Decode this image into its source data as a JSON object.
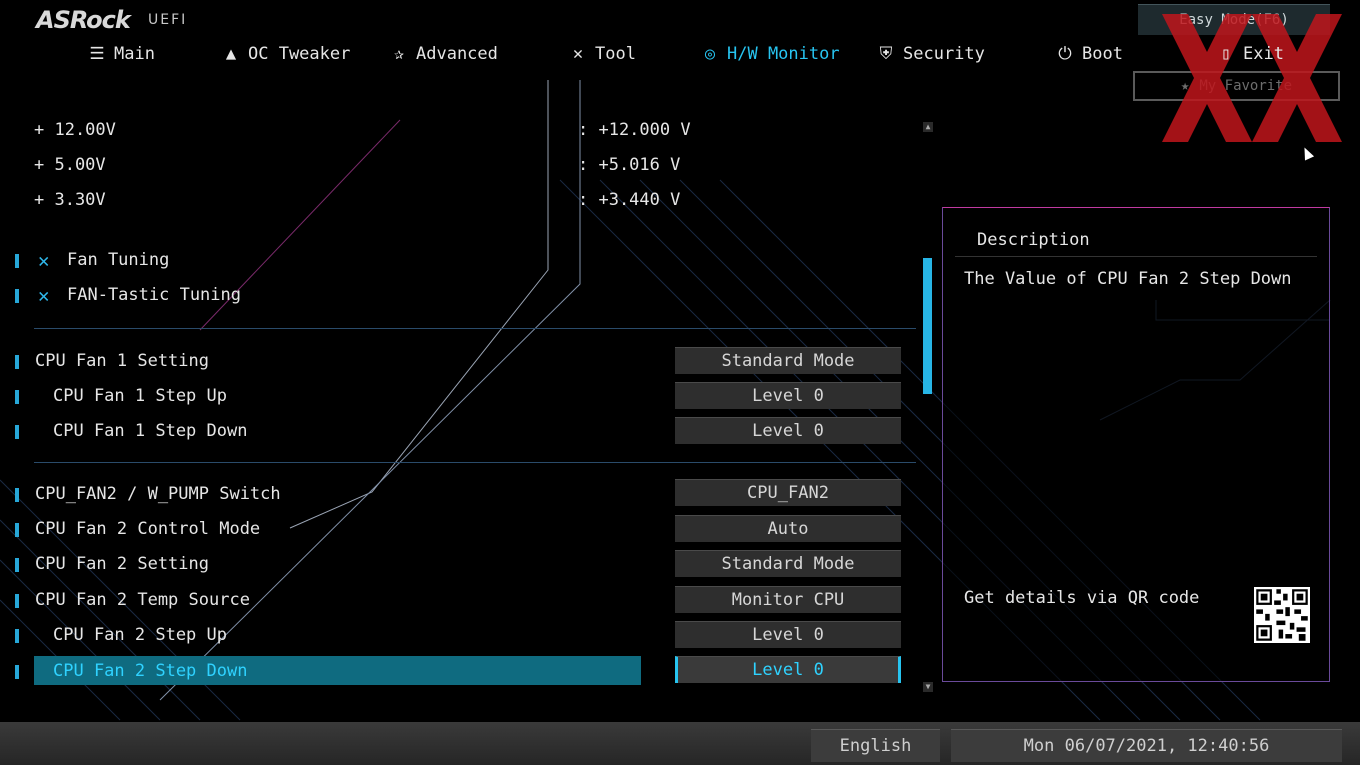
{
  "brand": {
    "logo": "ASRock",
    "sub": "UEFI"
  },
  "nav": [
    {
      "label": "Main",
      "icon": "list-icon"
    },
    {
      "label": "OC Tweaker",
      "icon": "rocket-icon"
    },
    {
      "label": "Advanced",
      "icon": "star-icon"
    },
    {
      "label": "Tool",
      "icon": "tools-icon"
    },
    {
      "label": "H/W Monitor",
      "icon": "monitor-icon"
    },
    {
      "label": "Security",
      "icon": "shield-icon"
    },
    {
      "label": "Boot",
      "icon": "power-icon"
    },
    {
      "label": "Exit",
      "icon": "exit-icon"
    }
  ],
  "active_tab": "H/W Monitor",
  "top_right": {
    "easy_mode": "Easy Mode(F6)",
    "favorite": "My Favorite"
  },
  "voltages": [
    {
      "label": "+ 12.00V",
      "value": ": +12.000 V"
    },
    {
      "label": "+ 5.00V",
      "value": ": +5.016 V"
    },
    {
      "label": "+ 3.30V",
      "value": ": +3.440 V"
    }
  ],
  "tools": [
    {
      "label": "Fan Tuning"
    },
    {
      "label": "FAN-Tastic Tuning"
    }
  ],
  "settings": [
    {
      "label": "CPU Fan 1 Setting",
      "value": "Standard Mode"
    },
    {
      "label": "CPU Fan 1 Step Up",
      "value": "Level 0"
    },
    {
      "label": "CPU Fan 1 Step Down",
      "value": "Level 0"
    },
    {
      "label": "CPU_FAN2 / W_PUMP Switch",
      "value": "CPU_FAN2"
    },
    {
      "label": "CPU Fan 2 Control Mode",
      "value": "Auto"
    },
    {
      "label": "CPU Fan 2 Setting",
      "value": "Standard Mode"
    },
    {
      "label": "CPU Fan 2 Temp Source",
      "value": "Monitor CPU"
    },
    {
      "label": "CPU Fan 2 Step Up",
      "value": "Level 0"
    },
    {
      "label": "CPU Fan 2 Step Down",
      "value": "Level 0"
    }
  ],
  "selected_setting": "CPU Fan 2 Step Down",
  "description": {
    "title": "Description",
    "text": "The Value of CPU Fan 2 Step Down",
    "qr_text": "Get details via QR code"
  },
  "footer": {
    "language": "English",
    "datetime": "Mon 06/07/2021, 12:40:56"
  },
  "colors": {
    "accent": "#27c4f0",
    "selection": "#0f6b80",
    "watermark": "#c0161c"
  }
}
